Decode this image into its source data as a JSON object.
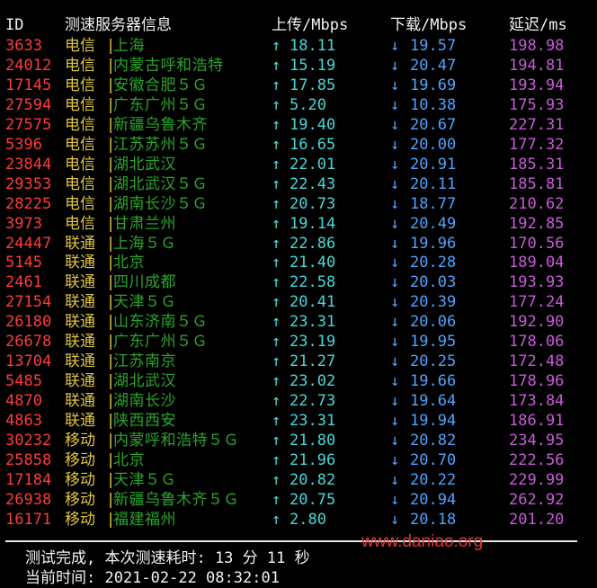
{
  "header": {
    "id": "ID",
    "node": "测速服务器信息",
    "upload": "上传/Mbps",
    "download": "下载/Mbps",
    "latency": "延迟/ms"
  },
  "separator": "|",
  "up_arrow": "↑",
  "down_arrow": "↓",
  "rows": [
    {
      "id": "3633",
      "isp": "电信",
      "node": "上海",
      "up": "18.11",
      "down": "19.57",
      "ping": "198.98"
    },
    {
      "id": "24012",
      "isp": "电信",
      "node": "内蒙古呼和浩特",
      "up": "15.19",
      "down": "20.47",
      "ping": "194.81"
    },
    {
      "id": "17145",
      "isp": "电信",
      "node": "安徽合肥５Ｇ",
      "up": "17.85",
      "down": "19.69",
      "ping": "193.94"
    },
    {
      "id": "27594",
      "isp": "电信",
      "node": "广东广州５Ｇ",
      "up": "5.20",
      "down": "10.38",
      "ping": "175.93"
    },
    {
      "id": "27575",
      "isp": "电信",
      "node": "新疆乌鲁木齐",
      "up": "19.40",
      "down": "20.67",
      "ping": "227.31"
    },
    {
      "id": "5396",
      "isp": "电信",
      "node": "江苏苏州５Ｇ",
      "up": "16.65",
      "down": "20.00",
      "ping": "177.32"
    },
    {
      "id": "23844",
      "isp": "电信",
      "node": "湖北武汉",
      "up": "22.01",
      "down": "20.91",
      "ping": "185.31"
    },
    {
      "id": "29353",
      "isp": "电信",
      "node": "湖北武汉５Ｇ",
      "up": "22.43",
      "down": "20.11",
      "ping": "185.81"
    },
    {
      "id": "28225",
      "isp": "电信",
      "node": "湖南长沙５Ｇ",
      "up": "20.73",
      "down": "18.77",
      "ping": "210.62"
    },
    {
      "id": "3973",
      "isp": "电信",
      "node": "甘肃兰州",
      "up": "19.14",
      "down": "20.49",
      "ping": "192.85"
    },
    {
      "id": "24447",
      "isp": "联通",
      "node": "上海５Ｇ",
      "up": "22.86",
      "down": "19.96",
      "ping": "170.56"
    },
    {
      "id": "5145",
      "isp": "联通",
      "node": "北京",
      "up": "21.40",
      "down": "20.28",
      "ping": "189.04"
    },
    {
      "id": "2461",
      "isp": "联通",
      "node": "四川成都",
      "up": "22.58",
      "down": "20.03",
      "ping": "193.93"
    },
    {
      "id": "27154",
      "isp": "联通",
      "node": "天津５Ｇ",
      "up": "20.41",
      "down": "20.39",
      "ping": "177.24"
    },
    {
      "id": "26180",
      "isp": "联通",
      "node": "山东济南５Ｇ",
      "up": "23.31",
      "down": "20.06",
      "ping": "192.90"
    },
    {
      "id": "26678",
      "isp": "联通",
      "node": "广东广州５Ｇ",
      "up": "23.19",
      "down": "19.95",
      "ping": "178.06"
    },
    {
      "id": "13704",
      "isp": "联通",
      "node": "江苏南京",
      "up": "21.27",
      "down": "20.25",
      "ping": "172.48"
    },
    {
      "id": "5485",
      "isp": "联通",
      "node": "湖北武汉",
      "up": "23.02",
      "down": "19.66",
      "ping": "178.96"
    },
    {
      "id": "4870",
      "isp": "联通",
      "node": "湖南长沙",
      "up": "22.73",
      "down": "19.64",
      "ping": "173.84"
    },
    {
      "id": "4863",
      "isp": "联通",
      "node": "陕西西安",
      "up": "23.31",
      "down": "19.94",
      "ping": "186.91"
    },
    {
      "id": "30232",
      "isp": "移动",
      "node": "内蒙呼和浩特５Ｇ",
      "up": "21.80",
      "down": "20.82",
      "ping": "234.95"
    },
    {
      "id": "25858",
      "isp": "移动",
      "node": "北京",
      "up": "21.96",
      "down": "20.70",
      "ping": "222.56"
    },
    {
      "id": "17184",
      "isp": "移动",
      "node": "天津５Ｇ",
      "up": "20.82",
      "down": "20.22",
      "ping": "229.99"
    },
    {
      "id": "26938",
      "isp": "移动",
      "node": "新疆乌鲁木齐５Ｇ",
      "up": "20.75",
      "down": "20.94",
      "ping": "262.92"
    },
    {
      "id": "16171",
      "isp": "移动",
      "node": "福建福州",
      "up": "2.80",
      "down": "20.18",
      "ping": "201.20"
    }
  ],
  "footer": {
    "completed": "测试完成, 本次测速耗时: 13 分 11 秒",
    "current_time": "当前时间: 2021-02-22 08:32:01"
  },
  "watermark": "www.daniao.org",
  "colors": {
    "background": "#000000",
    "id": "#ff3b3b",
    "isp": "#e0c640",
    "node": "#2aa52a",
    "upload": "#48d8d8",
    "download": "#4fa3ff",
    "latency": "#c85ad8",
    "watermark": "#d93a3a"
  }
}
